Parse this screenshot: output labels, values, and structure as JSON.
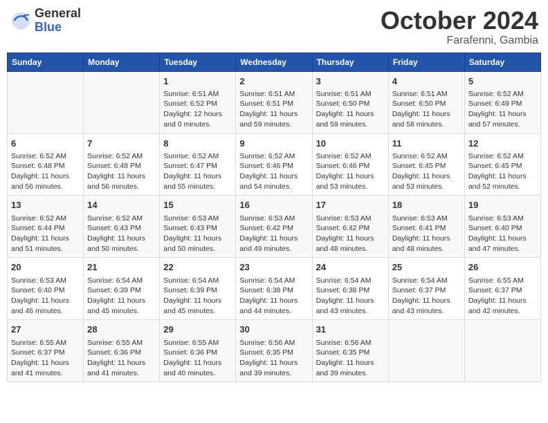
{
  "logo": {
    "general": "General",
    "blue": "Blue"
  },
  "title": "October 2024",
  "subtitle": "Farafenni, Gambia",
  "days_of_week": [
    "Sunday",
    "Monday",
    "Tuesday",
    "Wednesday",
    "Thursday",
    "Friday",
    "Saturday"
  ],
  "weeks": [
    [
      {
        "day": "",
        "detail": ""
      },
      {
        "day": "",
        "detail": ""
      },
      {
        "day": "1",
        "detail": "Sunrise: 6:51 AM\nSunset: 6:52 PM\nDaylight: 12 hours\nand 0 minutes."
      },
      {
        "day": "2",
        "detail": "Sunrise: 6:51 AM\nSunset: 6:51 PM\nDaylight: 11 hours\nand 59 minutes."
      },
      {
        "day": "3",
        "detail": "Sunrise: 6:51 AM\nSunset: 6:50 PM\nDaylight: 11 hours\nand 59 minutes."
      },
      {
        "day": "4",
        "detail": "Sunrise: 6:51 AM\nSunset: 6:50 PM\nDaylight: 11 hours\nand 58 minutes."
      },
      {
        "day": "5",
        "detail": "Sunrise: 6:52 AM\nSunset: 6:49 PM\nDaylight: 11 hours\nand 57 minutes."
      }
    ],
    [
      {
        "day": "6",
        "detail": "Sunrise: 6:52 AM\nSunset: 6:48 PM\nDaylight: 11 hours\nand 56 minutes."
      },
      {
        "day": "7",
        "detail": "Sunrise: 6:52 AM\nSunset: 6:48 PM\nDaylight: 11 hours\nand 56 minutes."
      },
      {
        "day": "8",
        "detail": "Sunrise: 6:52 AM\nSunset: 6:47 PM\nDaylight: 11 hours\nand 55 minutes."
      },
      {
        "day": "9",
        "detail": "Sunrise: 6:52 AM\nSunset: 6:46 PM\nDaylight: 11 hours\nand 54 minutes."
      },
      {
        "day": "10",
        "detail": "Sunrise: 6:52 AM\nSunset: 6:46 PM\nDaylight: 11 hours\nand 53 minutes."
      },
      {
        "day": "11",
        "detail": "Sunrise: 6:52 AM\nSunset: 6:45 PM\nDaylight: 11 hours\nand 53 minutes."
      },
      {
        "day": "12",
        "detail": "Sunrise: 6:52 AM\nSunset: 6:45 PM\nDaylight: 11 hours\nand 52 minutes."
      }
    ],
    [
      {
        "day": "13",
        "detail": "Sunrise: 6:52 AM\nSunset: 6:44 PM\nDaylight: 11 hours\nand 51 minutes."
      },
      {
        "day": "14",
        "detail": "Sunrise: 6:52 AM\nSunset: 6:43 PM\nDaylight: 11 hours\nand 50 minutes."
      },
      {
        "day": "15",
        "detail": "Sunrise: 6:53 AM\nSunset: 6:43 PM\nDaylight: 11 hours\nand 50 minutes."
      },
      {
        "day": "16",
        "detail": "Sunrise: 6:53 AM\nSunset: 6:42 PM\nDaylight: 11 hours\nand 49 minutes."
      },
      {
        "day": "17",
        "detail": "Sunrise: 6:53 AM\nSunset: 6:42 PM\nDaylight: 11 hours\nand 48 minutes."
      },
      {
        "day": "18",
        "detail": "Sunrise: 6:53 AM\nSunset: 6:41 PM\nDaylight: 11 hours\nand 48 minutes."
      },
      {
        "day": "19",
        "detail": "Sunrise: 6:53 AM\nSunset: 6:40 PM\nDaylight: 11 hours\nand 47 minutes."
      }
    ],
    [
      {
        "day": "20",
        "detail": "Sunrise: 6:53 AM\nSunset: 6:40 PM\nDaylight: 11 hours\nand 46 minutes."
      },
      {
        "day": "21",
        "detail": "Sunrise: 6:54 AM\nSunset: 6:39 PM\nDaylight: 11 hours\nand 45 minutes."
      },
      {
        "day": "22",
        "detail": "Sunrise: 6:54 AM\nSunset: 6:39 PM\nDaylight: 11 hours\nand 45 minutes."
      },
      {
        "day": "23",
        "detail": "Sunrise: 6:54 AM\nSunset: 6:38 PM\nDaylight: 11 hours\nand 44 minutes."
      },
      {
        "day": "24",
        "detail": "Sunrise: 6:54 AM\nSunset: 6:38 PM\nDaylight: 11 hours\nand 43 minutes."
      },
      {
        "day": "25",
        "detail": "Sunrise: 6:54 AM\nSunset: 6:37 PM\nDaylight: 11 hours\nand 43 minutes."
      },
      {
        "day": "26",
        "detail": "Sunrise: 6:55 AM\nSunset: 6:37 PM\nDaylight: 11 hours\nand 42 minutes."
      }
    ],
    [
      {
        "day": "27",
        "detail": "Sunrise: 6:55 AM\nSunset: 6:37 PM\nDaylight: 11 hours\nand 41 minutes."
      },
      {
        "day": "28",
        "detail": "Sunrise: 6:55 AM\nSunset: 6:36 PM\nDaylight: 11 hours\nand 41 minutes."
      },
      {
        "day": "29",
        "detail": "Sunrise: 6:55 AM\nSunset: 6:36 PM\nDaylight: 11 hours\nand 40 minutes."
      },
      {
        "day": "30",
        "detail": "Sunrise: 6:56 AM\nSunset: 6:35 PM\nDaylight: 11 hours\nand 39 minutes."
      },
      {
        "day": "31",
        "detail": "Sunrise: 6:56 AM\nSunset: 6:35 PM\nDaylight: 11 hours\nand 39 minutes."
      },
      {
        "day": "",
        "detail": ""
      },
      {
        "day": "",
        "detail": ""
      }
    ]
  ]
}
